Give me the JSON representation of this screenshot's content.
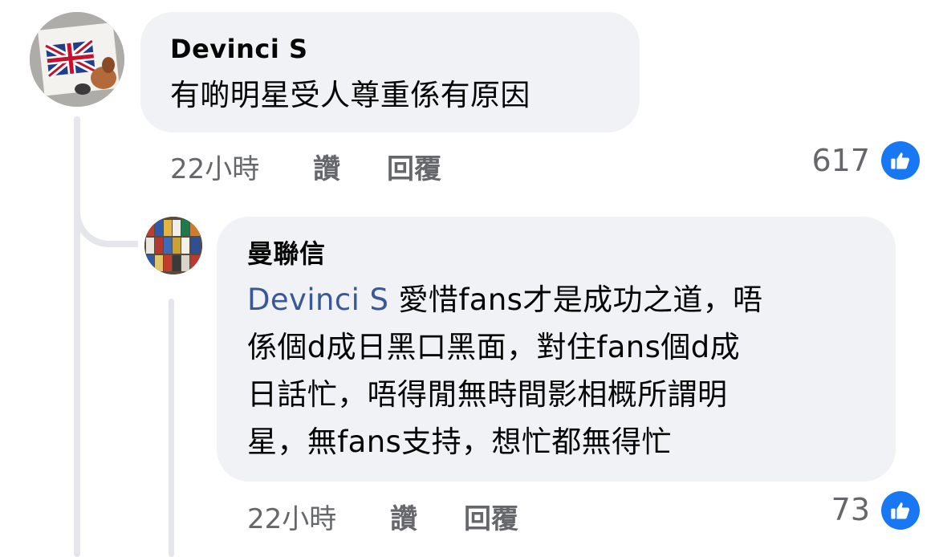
{
  "comments": [
    {
      "author": "Devinci S",
      "text": "有啲明星受人尊重係有原因",
      "time": "22小時",
      "like_label": "讚",
      "reply_label": "回覆",
      "reaction_count": "617",
      "reaction_icon": "thumbs-up-icon"
    }
  ],
  "reply": {
    "author": "曼聯信",
    "mention": "Devinci S",
    "lines": [
      " 愛惜fans才是成功之道，唔",
      "係個d成日黑口黑面，對住fans個d成",
      "日話忙，唔得閒無時間影相概所謂明",
      "星，無fans支持，想忙都無得忙"
    ],
    "time": "22小時",
    "like_label": "讚",
    "reply_label": "回覆",
    "reaction_count": "73",
    "reaction_icon": "thumbs-up-icon"
  },
  "colors": {
    "bubble": "#f0f2f5",
    "mention": "#385898",
    "meta": "#65676b",
    "like_badge": "#1877f2",
    "thread_line": "#e4e6eb"
  }
}
